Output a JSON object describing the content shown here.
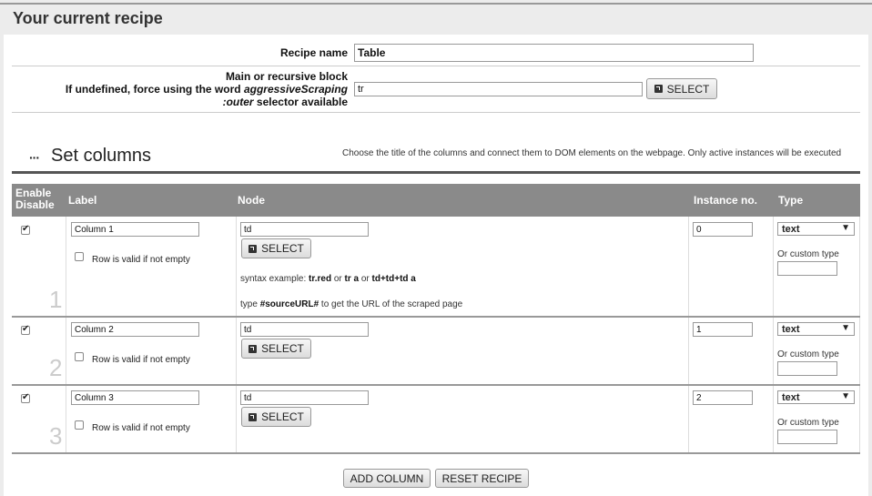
{
  "page": {
    "title": "Your current recipe"
  },
  "recipe": {
    "name_label": "Recipe name",
    "name_value": "Table",
    "block_label_line1": "Main or recursive block",
    "block_label_line2_prefix": "If undefined, force using the word ",
    "block_label_line2_em": "aggressiveScraping",
    "block_label_line3_em": ":outer",
    "block_label_line3_suffix": " selector available",
    "block_value": "tr",
    "select_label": "SELECT"
  },
  "columns_section": {
    "dots": "···",
    "title": "Set columns",
    "description": "Choose the title of the columns and connect them to DOM elements on the webpage. Only active instances will be executed"
  },
  "table": {
    "headers": {
      "enable_line1": "Enable",
      "enable_line2": "Disable",
      "label": "Label",
      "node": "Node",
      "instance": "Instance no.",
      "type": "Type"
    },
    "rows": [
      {
        "num": "1",
        "label": "Column 1",
        "node": "td",
        "instance": "0",
        "type": "text",
        "checked": true
      },
      {
        "num": "2",
        "label": "Column 2",
        "node": "td",
        "instance": "1",
        "type": "text",
        "checked": true
      },
      {
        "num": "3",
        "label": "Column 3",
        "node": "td",
        "instance": "2",
        "type": "text",
        "checked": true
      }
    ],
    "valid_label": "Row is valid if not empty",
    "select_label": "SELECT",
    "custom_type_label": "Or custom type",
    "syntax": {
      "prefix": "syntax example: ",
      "ex1": "tr.red",
      "or1": " or ",
      "ex2": "tr a",
      "or2": " or ",
      "ex3": "td+td+td a",
      "type_prefix": "type ",
      "source": "#sourceURL#",
      "type_suffix": " to get the URL of the scraped page"
    }
  },
  "footer": {
    "add_column": "ADD COLUMN",
    "reset_recipe": "RESET RECIPE"
  }
}
